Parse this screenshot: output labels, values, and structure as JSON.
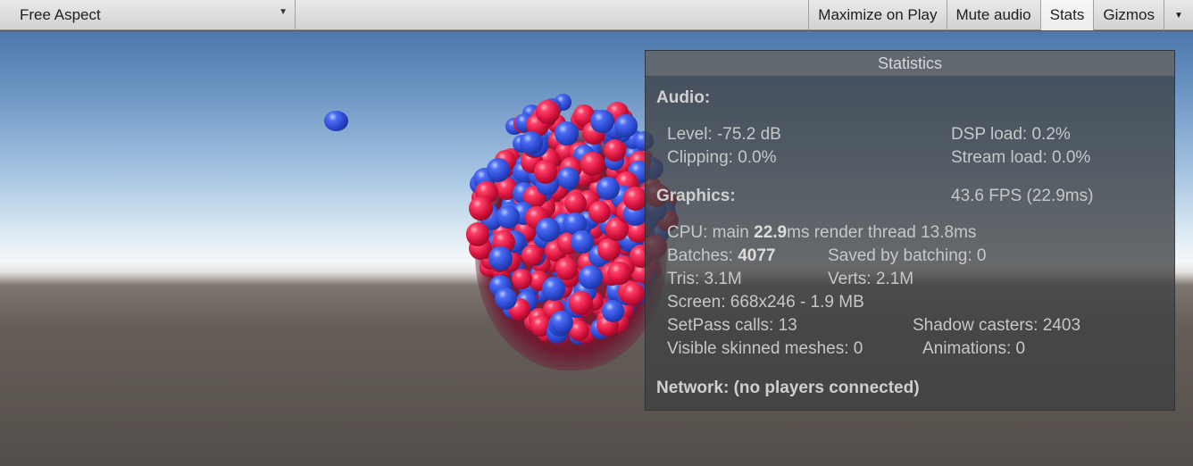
{
  "toolbar": {
    "aspect_label": "Free Aspect",
    "maximize_label": "Maximize on Play",
    "mute_label": "Mute audio",
    "stats_label": "Stats",
    "gizmos_label": "Gizmos"
  },
  "stats": {
    "title": "Statistics",
    "audio_header": "Audio:",
    "level": "Level: -75.2 dB",
    "dsp_load": "DSP load: 0.2%",
    "clipping": "Clipping: 0.0%",
    "stream_load": "Stream load: 0.0%",
    "graphics_header": "Graphics:",
    "fps": "43.6 FPS (22.9ms)",
    "cpu_prefix": "CPU: main ",
    "cpu_main": "22.9",
    "cpu_suffix": "ms  render thread 13.8ms",
    "batches_prefix": "Batches: ",
    "batches": "4077",
    "saved_by_batching": "Saved by batching: 0",
    "tris": "Tris: 3.1M",
    "verts": "Verts: 2.1M",
    "screen": "Screen: 668x246 - 1.9 MB",
    "setpass": "SetPass calls: 13",
    "shadow_casters": "Shadow casters: 2403",
    "skinned_meshes": "Visible skinned meshes: 0",
    "animations": "Animations: 0",
    "network": "Network: (no players connected)"
  },
  "colors": {
    "red_sphere": "#e0193f",
    "blue_sphere": "#3656e0",
    "panel_bg": "#3e4042"
  },
  "icons": {
    "aspect_dropdown": "triangle-down",
    "gizmos_dropdown": "triangle-down"
  }
}
